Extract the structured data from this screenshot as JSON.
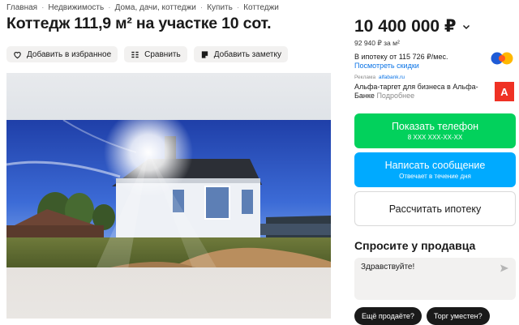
{
  "breadcrumb": [
    "Главная",
    "Недвижимость",
    "Дома, дачи, коттеджи",
    "Купить",
    "Коттеджи"
  ],
  "title": "Коттедж 111,9 м² на участке 10 сот.",
  "actions": {
    "favorite": "Добавить в избранное",
    "compare": "Сравнить",
    "note": "Добавить заметку"
  },
  "price": {
    "value": "10 400 000 ₽",
    "per_m2": "92 940 ₽ за м²",
    "mortgage": "В ипотеку от 115 726 ₽/мес.",
    "discount_link": "Посмотреть скидки"
  },
  "ad": {
    "label": "Реклама",
    "domain": "alfabank.ru",
    "text": "Альфа-таргет для бизнеса в Альфа-Банке",
    "more": "Подробнее",
    "logo_letter": "А"
  },
  "buttons": {
    "phone_main": "Показать телефон",
    "phone_sub": "8 XXX XXX-XX-XX",
    "message_main": "Написать сообщение",
    "message_sub": "Отвечает в течение дня",
    "mortgage": "Рассчитать ипотеку"
  },
  "ask": {
    "title": "Спросите у продавца",
    "message": "Здравствуйте!",
    "chips": [
      "Ещё продаёте?",
      "Торг уместен?"
    ]
  },
  "colors": {
    "phone_button": "#02d15c",
    "message_button": "#00aaff",
    "link": "#0a73e6",
    "alfa_red": "#ef3124"
  }
}
